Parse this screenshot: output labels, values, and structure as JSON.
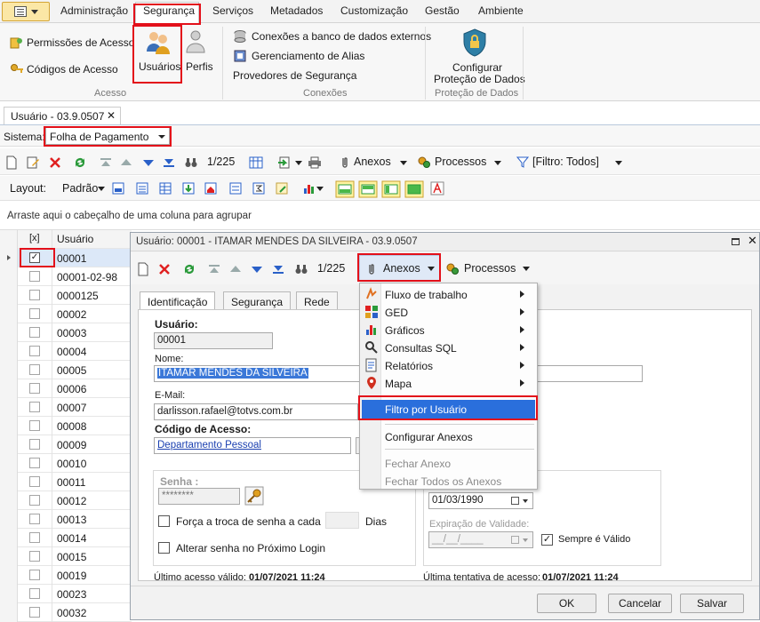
{
  "ribbon_tabs": [
    "Administração",
    "Segurança",
    "Serviços",
    "Metadados",
    "Customização",
    "Gestão",
    "Ambiente"
  ],
  "ribbon": {
    "acesso": {
      "items": [
        "Permissões de Acesso",
        "Códigos de Acesso"
      ],
      "usuarios": "Usuários",
      "perfis": "Perfis",
      "label": "Acesso"
    },
    "conexoes": {
      "items": [
        "Conexões a banco de dados externos",
        "Gerenciamento de Alias",
        "Provedores de Segurança"
      ],
      "label": "Conexões"
    },
    "protecao": {
      "line1": "Configurar",
      "line2": "Proteção de Dados",
      "label": "Proteção de Dados"
    }
  },
  "doc_tab": {
    "title": "Usuário - 03.9.0507",
    "close": "✕"
  },
  "sistema": {
    "label": "Sistema:",
    "value": "Folha de Pagamento"
  },
  "toolbar": {
    "counter": "1/225",
    "anexos": "Anexos",
    "processos": "Processos",
    "filtro": "[Filtro: Todos]"
  },
  "layout_bar": {
    "layout": "Layout:",
    "padrao": "Padrão"
  },
  "group_hint": "Arraste aqui o cabeçalho de uma coluna para agrupar",
  "grid": {
    "header_chk": "[x]",
    "header_col": "Usuário",
    "rows": [
      "00001",
      "00001-02-98",
      "0000125",
      "00002",
      "00003",
      "00004",
      "00005",
      "00006",
      "00007",
      "00008",
      "00009",
      "00010",
      "00011",
      "00012",
      "00013",
      "00014",
      "00015",
      "00019",
      "00023",
      "00032"
    ]
  },
  "dialog": {
    "title": "Usuário: 00001 - ITAMAR MENDES DA SILVEIRA - 03.9.0507",
    "counter": "1/225",
    "anexos": "Anexos",
    "processos": "Processos",
    "tabs": [
      "Identificação",
      "Segurança",
      "Rede"
    ],
    "usuario_label": "Usuário:",
    "usuario_value": "00001",
    "nome_label": "Nome:",
    "nome_value": "ITAMAR MENDES DA SILVEIRA",
    "email_label": "E-Mail:",
    "email_value": "darlisson.rafael@totvs.com.br",
    "codigo_label": "Código de Acesso:",
    "codigo_value": "Departamento Pessoal",
    "senha_label": "Senha :",
    "senha_value": "********",
    "forca_troca": "Força a troca de senha a cada",
    "dias": "Dias",
    "alterar_senha": "Alterar senha no Próximo Login",
    "data_value": "01/03/1990",
    "expiracao_label": "Expiração de Validade:",
    "expiracao_value": "__/__/____",
    "sempre_valido": "Sempre é Válido",
    "ultimo_acesso_label": "Último acesso válido:",
    "ultimo_acesso_value": "01/07/2021 11:24",
    "ultima_tentativa_label": "Última tentativa de acesso:",
    "ultima_tentativa_value": "01/07/2021 11:24",
    "ok": "OK",
    "cancelar": "Cancelar",
    "salvar": "Salvar"
  },
  "anexos_menu": {
    "items": [
      "Fluxo de trabalho",
      "GED",
      "Gráficos",
      "Consultas SQL",
      "Relatórios",
      "Mapa"
    ],
    "filtro": "Filtro por Usuário",
    "configurar": "Configurar Anexos",
    "fechar": "Fechar Anexo",
    "fechar_todos": "Fechar Todos os Anexos"
  },
  "colors": {
    "highlight": "#e3101a",
    "menu_selected": "#2a6fdc",
    "selection": "#3b78d8"
  }
}
